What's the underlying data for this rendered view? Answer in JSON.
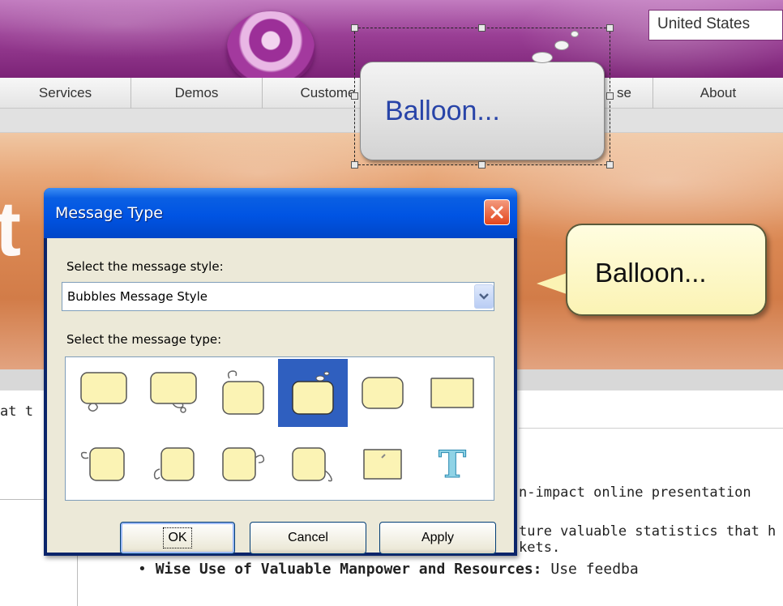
{
  "header": {
    "region_text": "United States"
  },
  "nav": {
    "items": [
      {
        "label": "Services"
      },
      {
        "label": "Demos"
      },
      {
        "label": "Custome"
      },
      {
        "label": "se"
      },
      {
        "label": "About"
      }
    ]
  },
  "banner": {
    "letter": "t"
  },
  "canvas": {
    "gray_balloon_text": "Balloon...",
    "yellow_balloon_text": "Balloon..."
  },
  "content": {
    "partial_left": "at t",
    "line1": "n-impact online presentation",
    "line2": "ture valuable statistics that h",
    "line3": "kets.",
    "bullet_bold": "Wise Use of Valuable Manpower and Resources:",
    "bullet_rest": " Use feedba"
  },
  "dialog": {
    "title": "Message Type",
    "style_label": "Select the message style:",
    "style_value": "Bubbles Message Style",
    "type_label": "Select the message type:",
    "selected_type_index": 3,
    "types": [
      {
        "icon": "balloon-tail-bottom-left-icon"
      },
      {
        "icon": "balloon-tail-bottom-right-icon"
      },
      {
        "icon": "balloon-tail-top-icon"
      },
      {
        "icon": "balloon-bubbles-top-right-icon"
      },
      {
        "icon": "rounded-rect-icon"
      },
      {
        "icon": "rect-icon"
      },
      {
        "icon": "balloon-tail-left-icon"
      },
      {
        "icon": "balloon-tail-left-bottom-icon"
      },
      {
        "icon": "balloon-tail-right-icon"
      },
      {
        "icon": "balloon-tail-right-bottom-icon"
      },
      {
        "icon": "note-icon"
      },
      {
        "icon": "text-icon",
        "glyph": "T"
      }
    ],
    "ok_label": "OK",
    "cancel_label": "Cancel",
    "apply_label": "Apply"
  },
  "colors": {
    "dialog_titlebar": "#0054e3",
    "dialog_face": "#ece9d8",
    "selection_highlight": "#2f5fbf",
    "balloon_fill": "#fbf3b4",
    "header_purple": "#9a3f95",
    "banner_orange": "#dc8a55"
  }
}
